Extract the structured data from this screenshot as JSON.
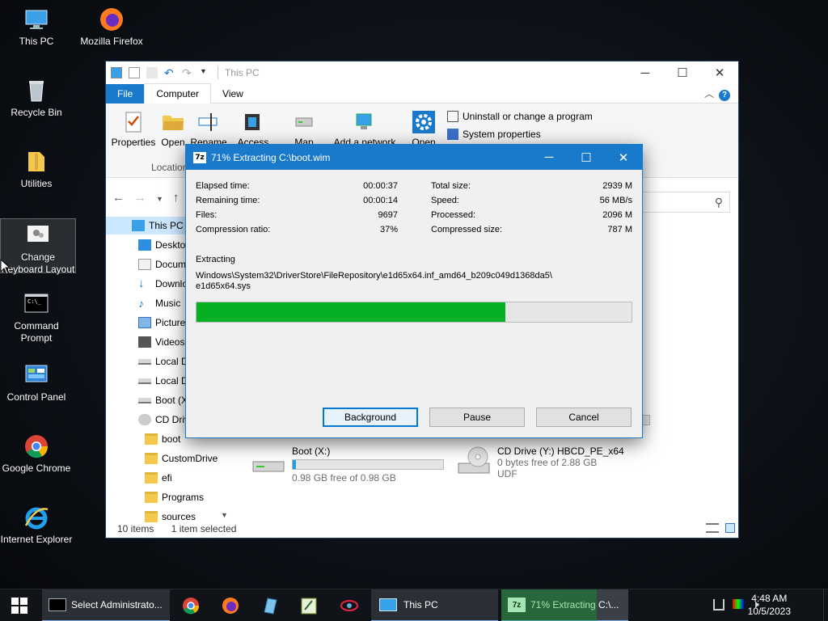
{
  "desktop": {
    "icons": [
      {
        "label": "This PC"
      },
      {
        "label": "Mozilla Firefox"
      },
      {
        "label": "Recycle Bin"
      },
      {
        "label": "Utilities"
      },
      {
        "label": "Change",
        "label2": "Keyboard Layout"
      },
      {
        "label": "Command",
        "label2": "Prompt"
      },
      {
        "label": "Control Panel"
      },
      {
        "label": "Google Chrome"
      },
      {
        "label": "Internet Explorer"
      }
    ]
  },
  "explorer": {
    "title": "This PC",
    "tabs": [
      "File",
      "Computer",
      "View"
    ],
    "ribbon": {
      "properties": "Properties",
      "open": "Open",
      "rename": "Rename",
      "access": "Access",
      "map_network": "Map network",
      "add_network": "Add a network",
      "open2": "Open",
      "uninstall": "Uninstall or change a program",
      "system_properties": "System properties",
      "location_group": "Location"
    },
    "tree": [
      "This PC",
      "Desktop",
      "Documents",
      "Downloads",
      "Music",
      "Pictures",
      "Videos",
      "Local Disk",
      "Local Disk",
      "Boot (X:)",
      "CD Drive",
      "boot",
      "CustomDrive",
      "efi",
      "Programs",
      "sources"
    ],
    "drives": [
      {
        "name": "Boot (X:)",
        "free": "0.98 GB free of 0.98 GB",
        "used": 0.02
      },
      {
        "name": "CD Drive (Y:) HBCD_PE_x64",
        "free": "0 bytes free of 2.88 GB",
        "fs": "UDF"
      }
    ],
    "status": {
      "items": "10 items",
      "selected": "1 item selected"
    }
  },
  "zip": {
    "title": "71% Extracting C:\\boot.wim",
    "progress": 0.71,
    "stats_left": [
      [
        "Elapsed time:",
        "00:00:37"
      ],
      [
        "Remaining time:",
        "00:00:14"
      ],
      [
        "Files:",
        "9697"
      ],
      [
        "Compression ratio:",
        "37%"
      ]
    ],
    "stats_right": [
      [
        "Total size:",
        "2939 M"
      ],
      [
        "Speed:",
        "56 MB/s"
      ],
      [
        "Processed:",
        "2096 M"
      ],
      [
        "Compressed size:",
        "787 M"
      ]
    ],
    "extracting_label": "Extracting",
    "path_line1": "Windows\\System32\\DriverStore\\FileRepository\\e1d65x64.inf_amd64_b209c049d1368da5\\",
    "path_line2": "e1d65x64.sys",
    "buttons": {
      "background": "Background",
      "pause": "Pause",
      "cancel": "Cancel"
    }
  },
  "taskbar": {
    "cmd": "Select Administrato...",
    "thispc": "This PC",
    "zip": "71% Extracting C:\\...",
    "time": "4:48 AM",
    "date": "10/5/2023"
  }
}
